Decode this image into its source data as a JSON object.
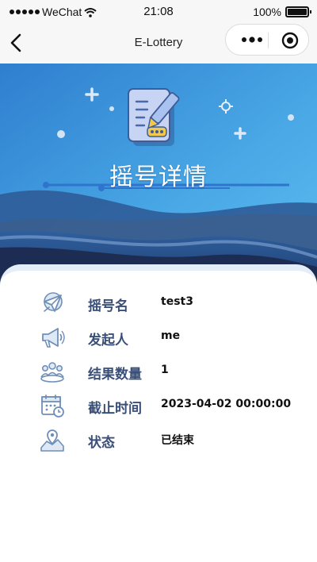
{
  "status_bar": {
    "carrier": "WeChat",
    "time": "21:08",
    "battery_label": "100%",
    "battery_level": 1.0
  },
  "nav": {
    "title": "E-Lottery",
    "back_icon": "chevron-left-icon",
    "more_icon": "ellipsis-icon",
    "close_icon": "record-icon"
  },
  "banner": {
    "title": "摇号详情",
    "colors": {
      "sky_top": "#2f7fcf",
      "sky_bottom": "#56b8ec",
      "wave_dark": "#1d2c52"
    }
  },
  "details": {
    "rows": [
      {
        "icon": "paper-plane-icon",
        "label": "摇号名",
        "value": "test3"
      },
      {
        "icon": "megaphone-icon",
        "label": "发起人",
        "value": "me"
      },
      {
        "icon": "group-icon",
        "label": "结果数量",
        "value": "1"
      },
      {
        "icon": "calendar-clock-icon",
        "label": "截止时间",
        "value": "2023-04-02 00:00:00"
      },
      {
        "icon": "map-pin-icon",
        "label": "状态",
        "value": "已结束"
      }
    ],
    "colors": {
      "label": "#3a4f78",
      "icon": "#6f8fb8"
    }
  }
}
